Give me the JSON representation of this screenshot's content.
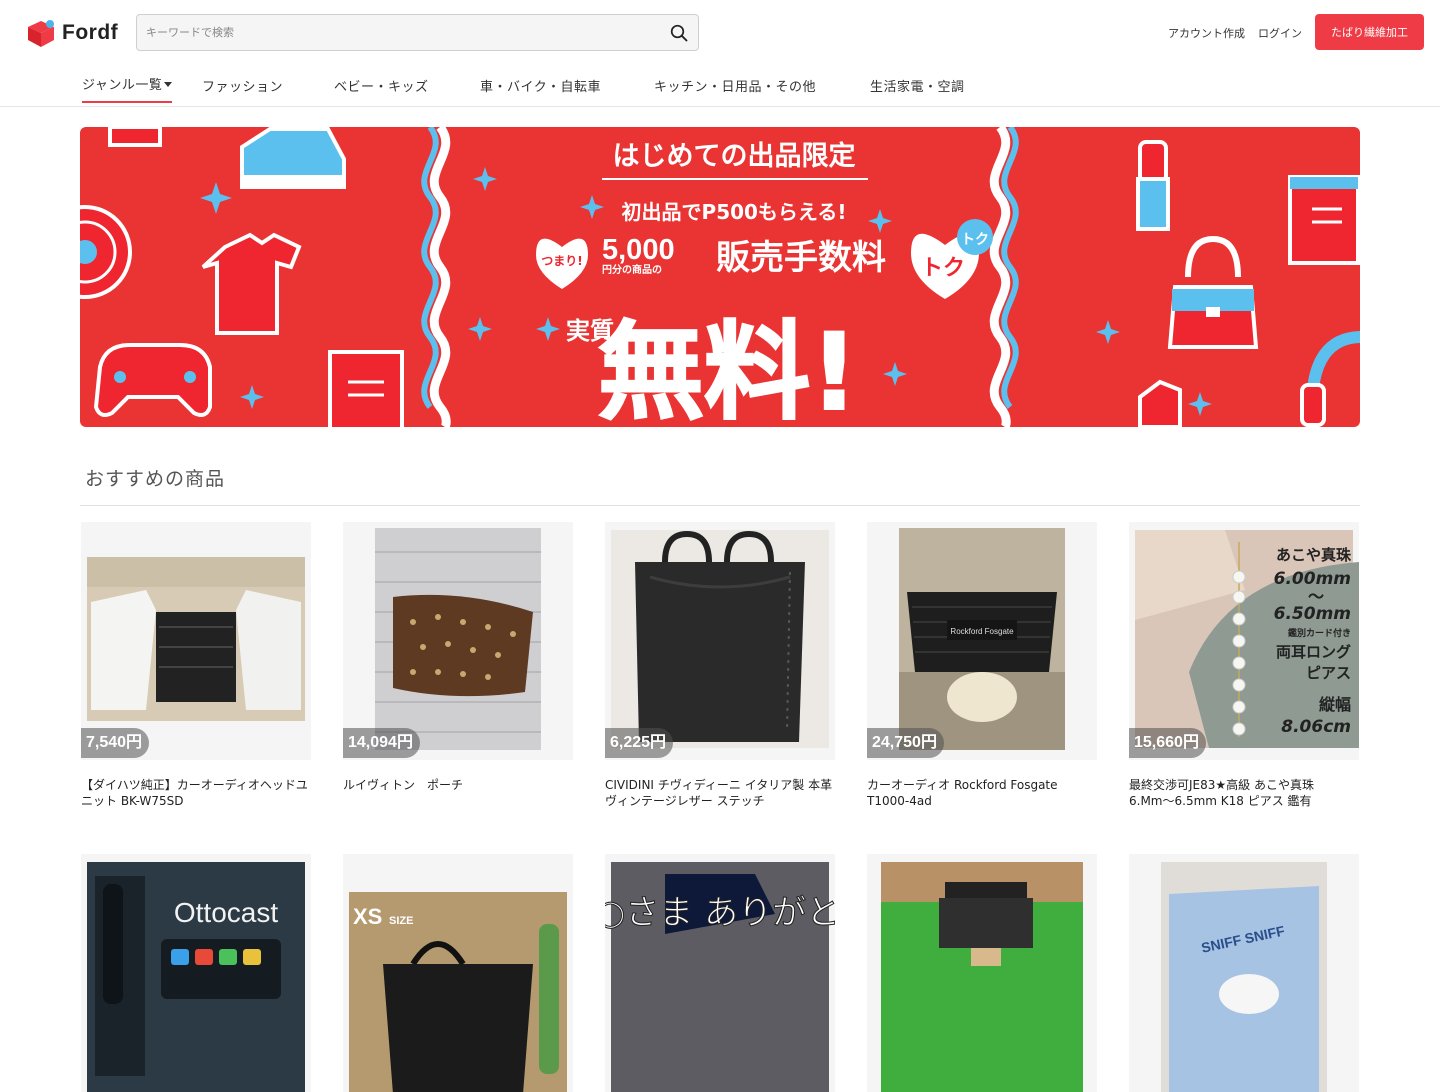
{
  "header": {
    "logo_text": "Fordf",
    "search_placeholder": "キーワードで検索",
    "signup": "アカウント作成",
    "login": "ログイン",
    "cta": "たばり繊維加工"
  },
  "nav": [
    {
      "label": "ジャンル一覧"
    },
    {
      "label": "ファッション"
    },
    {
      "label": "ベビー・キッズ"
    },
    {
      "label": "車・バイク・自転車"
    },
    {
      "label": "キッチン・日用品・その他"
    },
    {
      "label": "生活家電・空調"
    }
  ],
  "banner": {
    "headline": "はじめての出品限定",
    "sub": "初出品でP500もらえる!",
    "tsumari": "つまり!",
    "amount": "5,000",
    "amount_note": "円分の商品の",
    "fee": "販売手数料",
    "jisshitsu": "実質",
    "free": "無料!",
    "toku": "トク"
  },
  "section": {
    "title": "おすすめの商品"
  },
  "products": [
    {
      "price": "7,540円",
      "title": "【ダイハツ純正】カーオーディオヘッドユニット BK-W75SD"
    },
    {
      "price": "14,094円",
      "title": "ルイヴィトン　ポーチ"
    },
    {
      "price": "6,225円",
      "title": "CIVIDINI チヴィディーニ イタリア製 本革ヴィンテージレザー ステッチ"
    },
    {
      "price": "24,750円",
      "title": "カーオーディオ Rockford Fosgate T1000-4ad"
    },
    {
      "price": "15,660円",
      "title": "最終交渉可JE83★高級 あこや真珠 6.Mm〜6.5mm K18 ピアス 鑑有"
    },
    {
      "price": "",
      "title": ""
    },
    {
      "price": "",
      "title": ""
    },
    {
      "price": "",
      "title": ""
    },
    {
      "price": "",
      "title": ""
    },
    {
      "price": "",
      "title": ""
    }
  ],
  "image_text": {
    "pearl": [
      "あこや真珠",
      "6.00mm",
      "〜",
      "6.50mm",
      "鑑別カード付き",
      "両耳ロング",
      "ピアス",
      "縦幅",
      "8.06cm"
    ],
    "ottocast": "Ottocast",
    "xs": "XS",
    "xs_size": "SIZE",
    "rockford": "Rockford Fosgate",
    "snoopy": "SNIFF SNIFF",
    "handwriting": "○○さま ありがとう"
  }
}
